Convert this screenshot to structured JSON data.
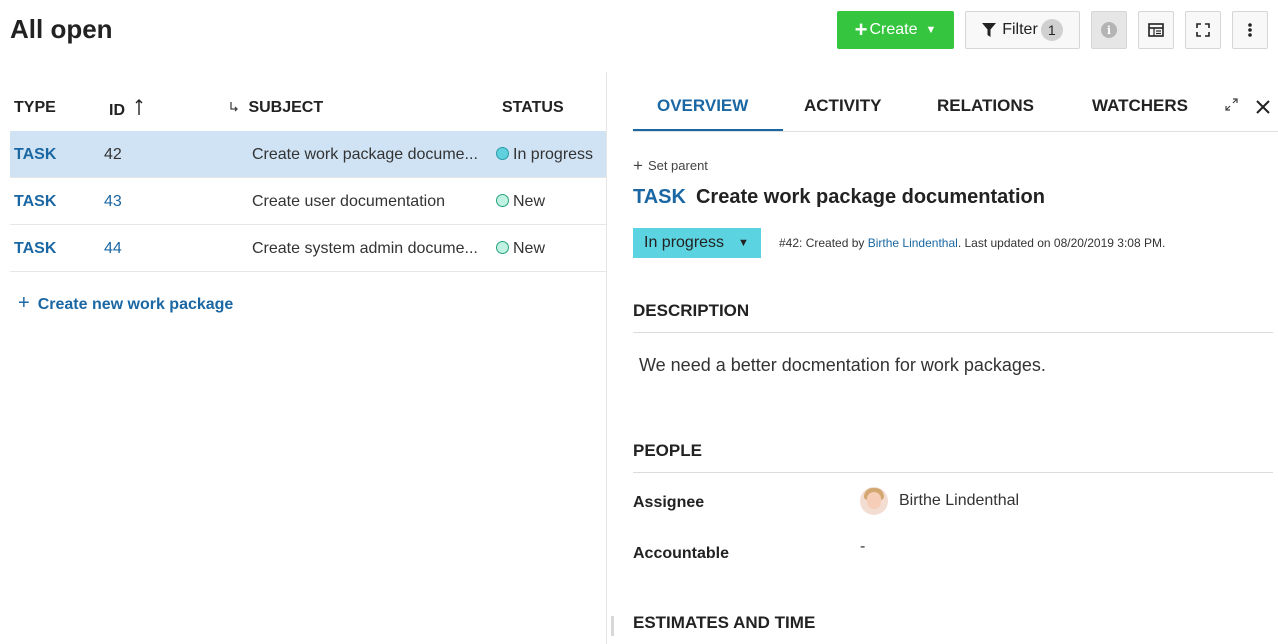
{
  "header": {
    "title": "All open",
    "create_label": "Create",
    "filter_label": "Filter",
    "filter_count": "1",
    "info_glyph": "i"
  },
  "table": {
    "columns": [
      "TYPE",
      "ID",
      "SUBJECT",
      "STATUS"
    ],
    "rows": [
      {
        "type": "TASK",
        "id": "42",
        "subject": "Create work package docume...",
        "status": "In progress",
        "selected": true
      },
      {
        "type": "TASK",
        "id": "43",
        "subject": "Create user documentation",
        "status": "New",
        "selected": false
      },
      {
        "type": "TASK",
        "id": "44",
        "subject": "Create system admin docume...",
        "status": "New",
        "selected": false
      }
    ],
    "create_new_label": "Create new work package"
  },
  "details": {
    "tabs": [
      {
        "label": "OVERVIEW",
        "active": true
      },
      {
        "label": "ACTIVITY",
        "active": false
      },
      {
        "label": "RELATIONS",
        "active": false
      },
      {
        "label": "WATCHERS",
        "active": false
      }
    ],
    "set_parent_label": "Set parent",
    "type": "TASK",
    "subject": "Create work package documentation",
    "status": "In progress",
    "meta_prefix": "#42: Created by ",
    "meta_author": "Birthe Lindenthal",
    "meta_suffix": ". Last updated on 08/20/2019 3:08 PM.",
    "description_heading": "DESCRIPTION",
    "description_text": "We need a better docmentation for work packages.",
    "people_heading": "PEOPLE",
    "assignee_label": "Assignee",
    "assignee_value": "Birthe Lindenthal",
    "accountable_label": "Accountable",
    "accountable_value": "-",
    "estimates_heading": "ESTIMATES AND TIME"
  },
  "icons": {
    "create": "plus-icon",
    "filter": "funnel-icon",
    "info": "info-icon",
    "columns": "columns-icon",
    "fullscreen": "fullscreen-icon",
    "more": "more-vertical-icon",
    "sort": "sort-ascending-icon",
    "hierarchy": "hierarchy-icon",
    "expand": "expand-icon",
    "close": "close-icon"
  },
  "colors": {
    "accent": "#1a67a3",
    "create_button": "#35c53f",
    "selected_row": "#cfe3f5",
    "status_in_progress": "#5cd3e0",
    "status_new": "#bff2e2"
  }
}
